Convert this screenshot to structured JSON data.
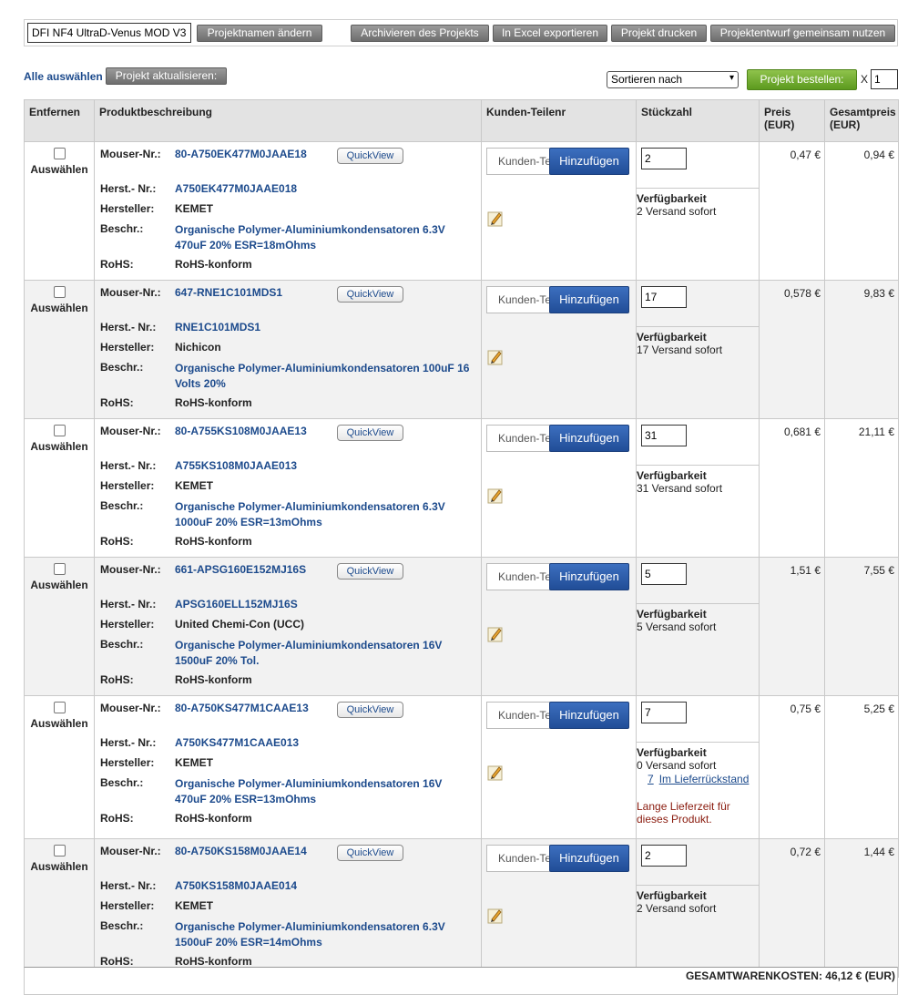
{
  "project": {
    "name": "DFI NF4 UltraD-Venus MOD V3",
    "rename_btn": "Projektnamen ändern",
    "archive_btn": "Archivieren des Projekts",
    "excel_btn": "In Excel exportieren",
    "print_btn": "Projekt drucken",
    "share_btn": "Projektentwurf gemeinsam nutzen"
  },
  "controls": {
    "select_all": "Alle auswählen",
    "update_btn": "Projekt aktualisieren:",
    "sort_selected": "Sortieren nach",
    "order_btn": "Projekt bestellen:",
    "x_label": "X",
    "order_qty": "1"
  },
  "table": {
    "headers": {
      "remove": "Entfernen",
      "desc": "Produktbeschreibung",
      "customer": "Kunden-Teilenr",
      "qty": "Stückzahl",
      "price": "Preis (EUR)",
      "total": "Gesamtpreis (EUR)"
    },
    "labels": {
      "select": "Auswählen",
      "mouser": "Mouser-Nr.:",
      "mfr_no": "Herst.- Nr.:",
      "mfr": "Hersteller:",
      "desc": "Beschr.:",
      "rohs": "RoHS:",
      "quickview": "QuickView",
      "customer_placeholder": "Kunden-Teilenr",
      "add_btn": "Hinzufügen",
      "availability": "Verfügbarkeit"
    },
    "rows": [
      {
        "mouser": "80-A750EK477M0JAAE18",
        "mfr_no": "A750EK477M0JAAE018",
        "mfr": "KEMET",
        "desc_line1": "Organische Polymer-Aluminiumkondensatoren 6.3V",
        "desc_line2": "470uF 20% ESR=18mOhms",
        "rohs": "RoHS-konform",
        "qty": "2",
        "avail": "2 Versand sofort",
        "price": "0,47 €",
        "total": "0,94 €"
      },
      {
        "mouser": "647-RNE1C101MDS1",
        "mfr_no": "RNE1C101MDS1",
        "mfr": "Nichicon",
        "desc_line1": "Organische Polymer-Aluminiumkondensatoren 100uF 16",
        "desc_line2": "Volts 20%",
        "rohs": "RoHS-konform",
        "qty": "17",
        "avail": "17 Versand sofort",
        "price": "0,578 €",
        "total": "9,83 €"
      },
      {
        "mouser": "80-A755KS108M0JAAE13",
        "mfr_no": "A755KS108M0JAAE013",
        "mfr": "KEMET",
        "desc_line1": "Organische Polymer-Aluminiumkondensatoren 6.3V",
        "desc_line2": "1000uF 20% ESR=13mOhms",
        "rohs": "RoHS-konform",
        "qty": "31",
        "avail": "31 Versand sofort",
        "price": "0,681 €",
        "total": "21,11 €"
      },
      {
        "mouser": "661-APSG160E152MJ16S",
        "mfr_no": "APSG160ELL152MJ16S",
        "mfr": "United Chemi-Con (UCC)",
        "desc_line1": "Organische Polymer-Aluminiumkondensatoren 16V",
        "desc_line2": "1500uF 20% Tol.",
        "rohs": "RoHS-konform",
        "qty": "5",
        "avail": "5 Versand sofort",
        "price": "1,51 €",
        "total": "7,55 €"
      },
      {
        "mouser": "80-A750KS477M1CAAE13",
        "mfr_no": "A750KS477M1CAAE013",
        "mfr": "KEMET",
        "desc_line1": "Organische Polymer-Aluminiumkondensatoren 16V",
        "desc_line2": "470uF 20% ESR=13mOhms",
        "rohs": "RoHS-konform",
        "qty": "7",
        "avail": "0 Versand sofort",
        "backorder_qty": "7",
        "backorder_text": "Im Lieferrückstand",
        "leadtime_line1": "Lange Lieferzeit für",
        "leadtime_line2": "dieses Produkt.",
        "price": "0,75 €",
        "total": "5,25 €"
      },
      {
        "mouser": "80-A750KS158M0JAAE14",
        "mfr_no": "A750KS158M0JAAE014",
        "mfr": "KEMET",
        "desc_line1": "Organische Polymer-Aluminiumkondensatoren 6.3V",
        "desc_line2": "1500uF 20% ESR=14mOhms",
        "rohs": "RoHS-konform",
        "qty": "2",
        "avail": "2 Versand sofort",
        "price": "0,72 €",
        "total": "1,44 €"
      }
    ]
  },
  "footer": {
    "total_text": "GESAMTWARENKOSTEN: 46,12 € (EUR)"
  },
  "icons": {
    "edit": "pencil-icon",
    "sort": "chevron-down-icon"
  }
}
